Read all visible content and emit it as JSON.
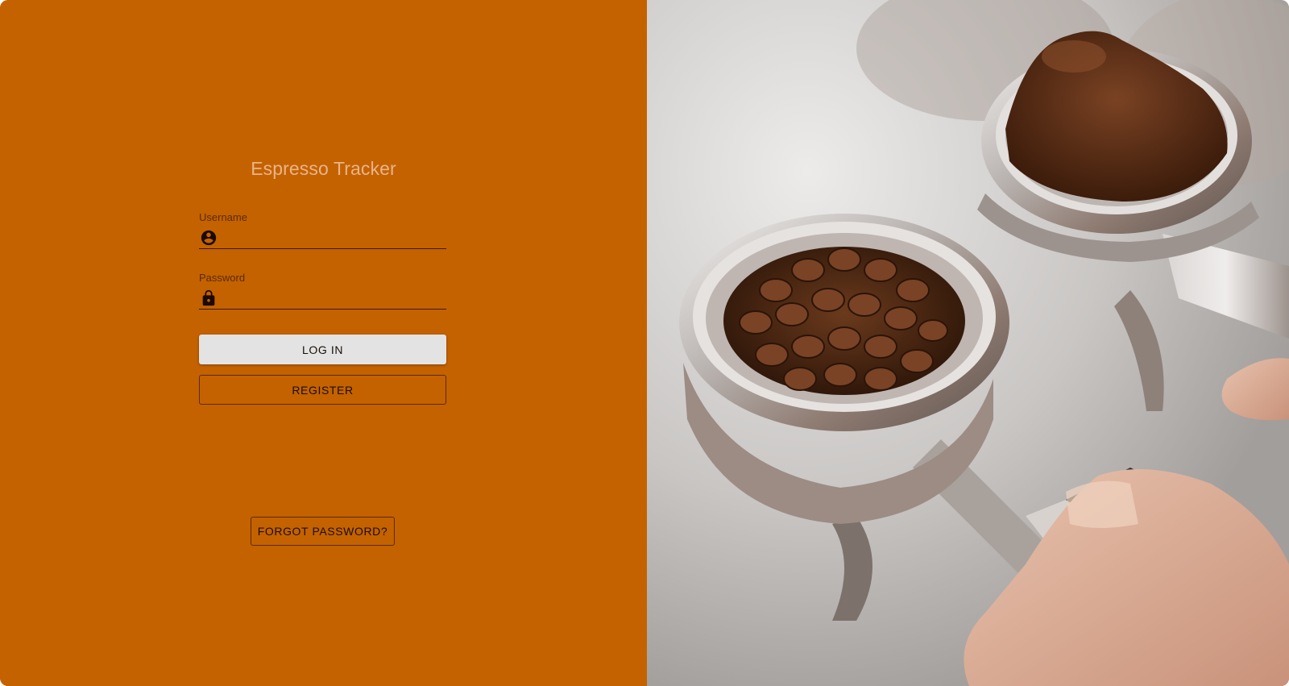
{
  "app": {
    "title": "Espresso Tracker"
  },
  "login_form": {
    "username": {
      "label": "Username",
      "value": "",
      "icon": "account-circle-icon"
    },
    "password": {
      "label": "Password",
      "value": "",
      "icon": "lock-icon"
    },
    "login_label": "LOG IN",
    "register_label": "REGISTER",
    "forgot_label": "FORGOT PASSWORD?"
  },
  "colors": {
    "panel_background": "#c46200",
    "title_text": "#e9b48a",
    "primary_button": "#e3e3e3"
  }
}
